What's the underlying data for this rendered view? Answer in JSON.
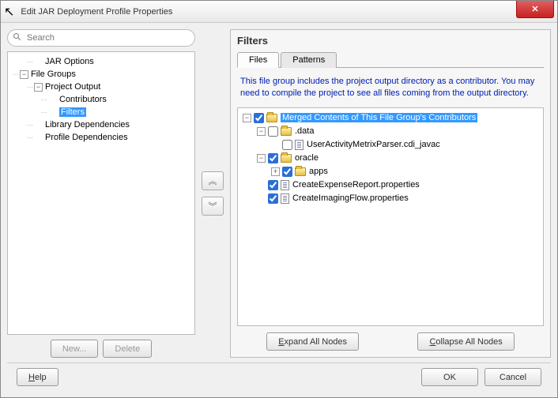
{
  "window": {
    "title": "Edit JAR Deployment Profile Properties"
  },
  "search": {
    "placeholder": "Search"
  },
  "navTree": {
    "items": [
      {
        "label": "JAR Options",
        "indent": 1,
        "exp": "",
        "sel": false
      },
      {
        "label": "File Groups",
        "indent": 0,
        "exp": "−",
        "sel": false
      },
      {
        "label": "Project Output",
        "indent": 1,
        "exp": "−",
        "sel": false
      },
      {
        "label": "Contributors",
        "indent": 2,
        "exp": "",
        "sel": false
      },
      {
        "label": "Filters",
        "indent": 2,
        "exp": "",
        "sel": true
      },
      {
        "label": "Library Dependencies",
        "indent": 1,
        "exp": "",
        "sel": false
      },
      {
        "label": "Profile Dependencies",
        "indent": 1,
        "exp": "",
        "sel": false
      }
    ]
  },
  "leftButtons": {
    "new": "New...",
    "delete": "Delete"
  },
  "midButtons": {
    "up": "︽",
    "down": "︾"
  },
  "right": {
    "heading": "Filters",
    "tabs": {
      "files": "Files",
      "patterns": "Patterns"
    },
    "info": "This file group includes the project output directory as a contributor.  You may need to compile the project to see all files coming from the output directory.",
    "tree": [
      {
        "label": "Merged Contents of This File Group's Contributors",
        "indent": 0,
        "exp": "−",
        "chk": true,
        "icon": "folder",
        "sel": true
      },
      {
        "label": ".data",
        "indent": 1,
        "exp": "−",
        "chk": false,
        "icon": "folder",
        "sel": false
      },
      {
        "label": "UserActivityMetrixParser.cdi_javac",
        "indent": 2,
        "exp": "",
        "chk": false,
        "icon": "file",
        "sel": false
      },
      {
        "label": "oracle",
        "indent": 1,
        "exp": "−",
        "chk": true,
        "icon": "folder",
        "sel": false
      },
      {
        "label": "apps",
        "indent": 2,
        "exp": "+",
        "chk": true,
        "icon": "folder",
        "sel": false
      },
      {
        "label": "CreateExpenseReport.properties",
        "indent": 1,
        "exp": "",
        "chk": true,
        "icon": "file",
        "sel": false
      },
      {
        "label": "CreateImagingFlow.properties",
        "indent": 1,
        "exp": "",
        "chk": true,
        "icon": "file",
        "sel": false
      }
    ],
    "expandAll": "Expand All Nodes",
    "collapseAll": "Collapse All Nodes"
  },
  "footer": {
    "help": "Help",
    "ok": "OK",
    "cancel": "Cancel"
  }
}
